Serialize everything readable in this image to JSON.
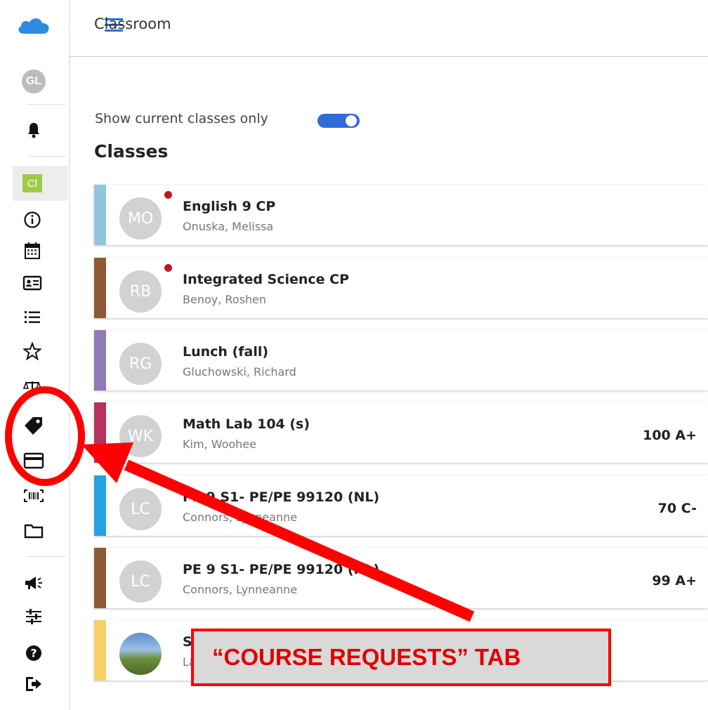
{
  "app": {
    "title": "Classroom"
  },
  "sidebar": {
    "avatar_initials": "GL",
    "section_badge": "Cl",
    "icons": [
      "cloud-icon",
      "user-avatar",
      "bell-icon",
      "classroom-badge",
      "info-icon",
      "calendar-icon",
      "id-card-icon",
      "list-icon",
      "star-icon",
      "scale-icon",
      "tag-icon",
      "credit-card-icon",
      "barcode-icon",
      "folder-icon",
      "megaphone-icon",
      "sliders-icon",
      "help-icon",
      "logout-icon"
    ]
  },
  "toggle": {
    "label": "Show current classes only",
    "on": true
  },
  "classes_heading": "Classes",
  "classes": [
    {
      "initials": "MO",
      "name": "English 9 CP",
      "teacher": "Onuska, Melissa",
      "grade": "",
      "color": "#93c4de",
      "notify": true
    },
    {
      "initials": "RB",
      "name": "Integrated Science CP",
      "teacher": "Benoy, Roshen",
      "grade": "",
      "color": "#8d5a36",
      "notify": true
    },
    {
      "initials": "RG",
      "name": "Lunch (fall)",
      "teacher": "Gluchowski, Richard",
      "grade": "",
      "color": "#8e7ab5",
      "notify": false
    },
    {
      "initials": "WK",
      "name": "Math Lab 104 (s)",
      "teacher": "Kim, Woohee",
      "grade": "100 A+",
      "color": "#b8325f",
      "notify": false
    },
    {
      "initials": "LC",
      "name": "PE 9 S1- PE/PE 99120 (NL)",
      "teacher": "Connors, Lynneanne",
      "grade": "70 C-",
      "color": "#24a3e0",
      "notify": false
    },
    {
      "initials": "LC",
      "name": "PE 9 S1- PE/PE 99120 (NL)",
      "teacher": "Connors, Lynneanne",
      "grade": "99 A+",
      "color": "#8d5a36",
      "notify": false
    },
    {
      "initials": "",
      "name": "S",
      "teacher": "La",
      "grade": "",
      "color": "#f7d06a",
      "notify": false
    }
  ],
  "annotation": {
    "callout": "“COURSE REQUESTS” TAB",
    "color": "#ff0000"
  }
}
